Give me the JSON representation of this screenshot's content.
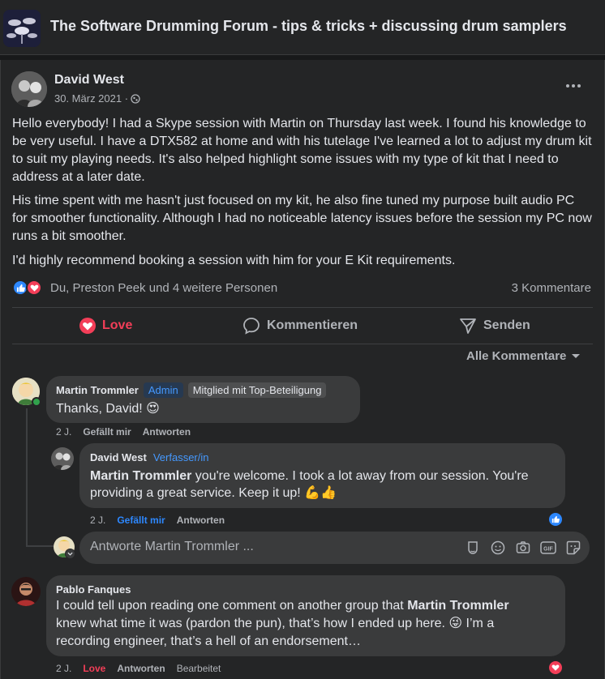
{
  "group": {
    "title": "The Software Drumming Forum - tips & tricks + discussing drum samplers",
    "thumb_icon": "drum-kit-icon"
  },
  "post": {
    "author": "David West",
    "date": "30. März 2021 ·",
    "privacy_icon": "globe-icon",
    "paragraphs": [
      "Hello everybody! I had a Skype session with Martin on Thursday last week. I found his knowledge to be very useful. I have a DTX582 at home and with his tutelage I've learned a lot to adjust my drum kit to suit my playing needs. It's also helped highlight some issues with my type of kit that I need to address at a later date.",
      "His time spent with me hasn't just focused on my kit, he also fine tuned my purpose built audio PC for smoother functionality. Although I had no noticeable latency issues before the session my PC now runs a bit smoother.",
      "I'd highly recommend booking a session with him for your E Kit requirements."
    ],
    "reactors": "Du, Preston Peek und 4 weitere Personen",
    "comment_count": "3 Kommentare"
  },
  "actions": {
    "love": "Love",
    "comment": "Kommentieren",
    "send": "Senden"
  },
  "sort_label": "Alle Kommentare",
  "comments": [
    {
      "name": "Martin Trommler",
      "badges": [
        "Admin",
        "Mitglied mit Top-Beteiligung"
      ],
      "text": "Thanks, David! 😍",
      "time": "2 J.",
      "like": "Gefällt mir",
      "reply": "Antworten"
    },
    {
      "name": "David West",
      "badge": "Verfasser/in",
      "mention": "Martin Trommler",
      "text": " you're welcome. I took a lot away from our session. You're providing a great service. Keep it up! 💪👍",
      "time": "2 J.",
      "like": "Gefällt mir",
      "reply": "Antworten"
    },
    {
      "name": "Pablo Fanques",
      "text_before": "I could tell upon reading one comment on another group that ",
      "mention": "Martin Trommler",
      "text_after": " knew what time it was (pardon the pun), that’s how I ended up here. 😜 I’m a recording engineer, that’s a hell of an endorsement…",
      "time": "2 J.",
      "like": "Love",
      "reply": "Antworten",
      "edited": "Bearbeitet"
    }
  ],
  "reply_box": {
    "placeholder": "Antworte Martin Trommler ...",
    "tools": [
      "sticker-avatar-icon",
      "emoji-icon",
      "camera-icon",
      "gif-icon",
      "sticker-icon"
    ]
  },
  "colors": {
    "background": "#18191a",
    "card": "#242526",
    "bubble": "#3a3b3c",
    "love": "#f33e58",
    "like": "#2d88ff",
    "link": "#4599ff",
    "secondary_text": "#b0b3b8"
  }
}
